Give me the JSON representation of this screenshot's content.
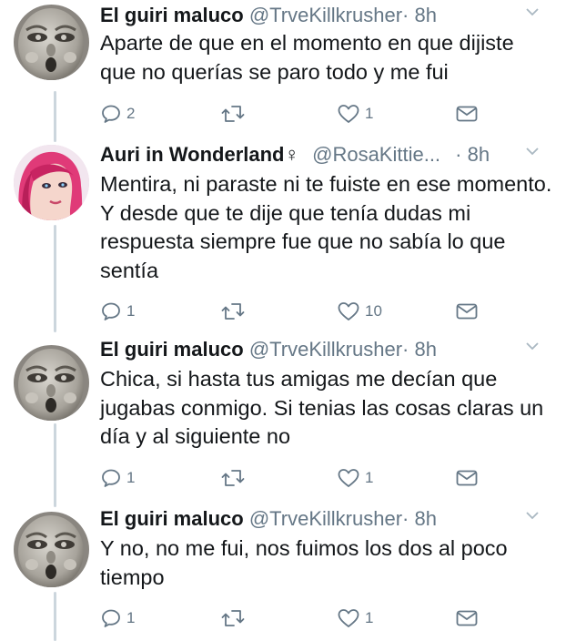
{
  "tweets": [
    {
      "name": "El guiri maluco",
      "handle": "@TrveKillkrusher",
      "time": "· 8h",
      "text": "Aparte de que en el momento en que dijiste que no querías se paro todo y me fui",
      "replies": "2",
      "retweets": "",
      "likes": "1"
    },
    {
      "name": "Auri in Wonderland♀",
      "handle": "@RosaKittie...",
      "time": "· 8h",
      "text": "Mentira, ni paraste ni te fuiste en ese momento. Y desde que te dije que tenía dudas mi respuesta siempre fue que no sabía lo que sentía",
      "replies": "1",
      "retweets": "",
      "likes": "10"
    },
    {
      "name": "El guiri maluco",
      "handle": "@TrveKillkrusher",
      "time": "· 8h",
      "text": "Chica, si hasta tus amigas me decían que jugabas conmigo. Si tenias las cosas claras un día y al siguiente no",
      "replies": "1",
      "retweets": "",
      "likes": "1"
    },
    {
      "name": "El guiri maluco",
      "handle": "@TrveKillkrusher",
      "time": "· 8h",
      "text": "Y no, no me fui, nos fuimos los dos al poco tiempo",
      "replies": "1",
      "retweets": "",
      "likes": "1"
    }
  ],
  "colors": {
    "text": "#14171a",
    "secondary": "#657786",
    "thread_line": "#ccd6dd"
  },
  "icons": [
    "reply-icon",
    "retweet-icon",
    "like-icon",
    "message-icon",
    "chevron-down-icon"
  ]
}
